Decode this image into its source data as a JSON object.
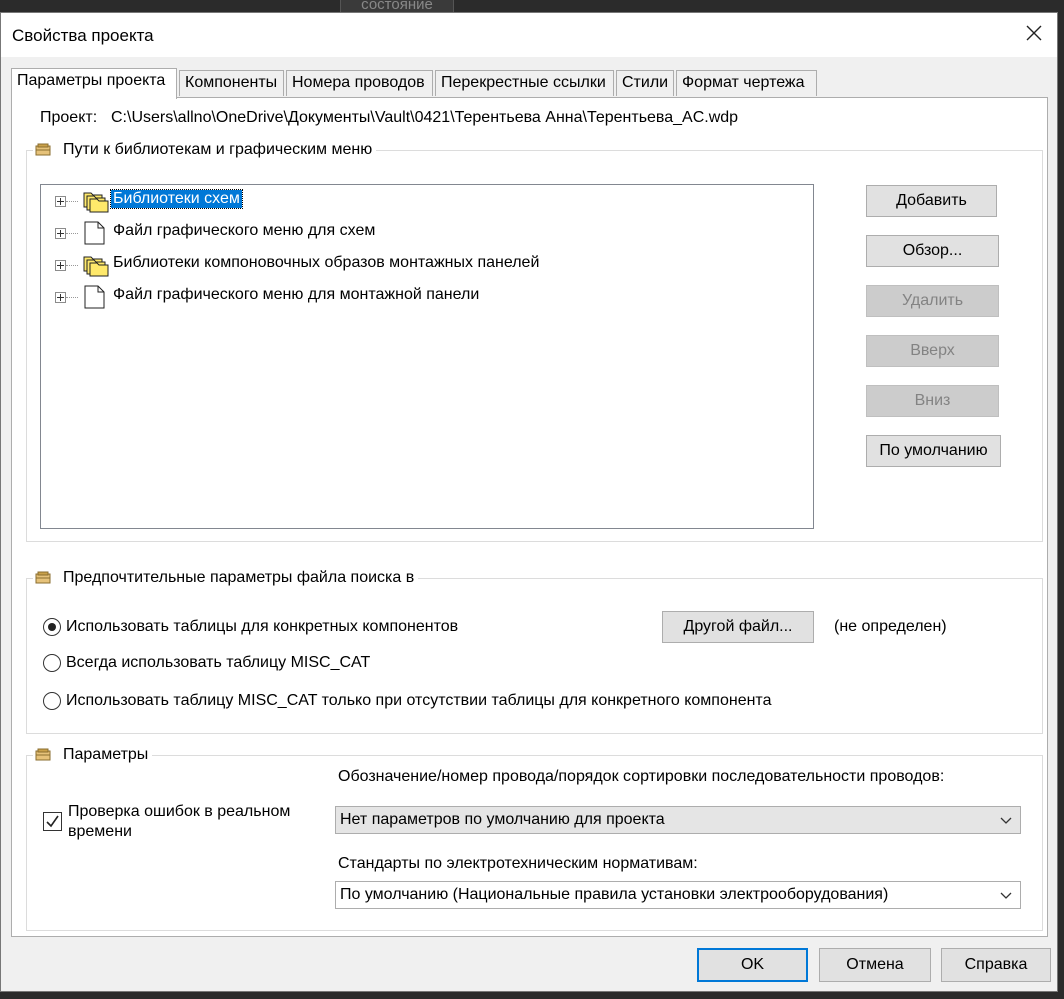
{
  "background_window": {
    "tab_label": "состояние"
  },
  "dialog": {
    "title": "Свойства проекта"
  },
  "tabs": [
    {
      "label": "Параметры проекта",
      "active": true
    },
    {
      "label": "Компоненты"
    },
    {
      "label": "Номера проводов"
    },
    {
      "label": "Перекрестные ссылки"
    },
    {
      "label": "Стили"
    },
    {
      "label": "Формат чертежа"
    }
  ],
  "project": {
    "label": "Проект:",
    "path": "C:\\Users\\allno\\OneDrive\\Документы\\Vault\\0421\\Терентьева Анна\\Терентьева_AC.wdp"
  },
  "library_group": {
    "title": "Пути к библиотекам и графическим меню",
    "tree_items": [
      {
        "label": "Библиотеки схем",
        "icon": "folders-icon",
        "selected": true
      },
      {
        "label": "Файл графического меню для схем",
        "icon": "file-icon"
      },
      {
        "label": "Библиотеки компоновочных образов монтажных панелей",
        "icon": "folders-icon"
      },
      {
        "label": "Файл графического меню для монтажной панели",
        "icon": "file-icon"
      }
    ],
    "buttons": {
      "add": "Добавить",
      "browse": "Обзор...",
      "remove": "Удалить",
      "up": "Вверх",
      "down": "Вниз",
      "default": "По умолчанию"
    }
  },
  "search_group": {
    "title": "Предпочтительные параметры файла поиска в",
    "options": [
      {
        "label": "Использовать таблицы для конкретных компонентов",
        "selected": true
      },
      {
        "label": "Всегда использовать таблицу MISC_CAT",
        "selected": false
      },
      {
        "label": "Использовать таблицу MISC_CAT только при отсутствии таблицы для конкретного компонента",
        "selected": false
      }
    ],
    "other_file_button": "Другой файл...",
    "other_file_status": "(не определен)"
  },
  "params_group": {
    "title": "Параметры",
    "realtime_check": {
      "label_line1": "Проверка ошибок в реальном",
      "label_line2": "времени",
      "checked": true
    },
    "wire_sort_label": "Обозначение/номер провода/порядок сортировки последовательности проводов:",
    "wire_sort_value": "Нет параметров по умолчанию для проекта",
    "standards_label": "Стандарты по электротехническим нормативам:",
    "standards_value": "По умолчанию (Национальные правила установки электрооборудования)"
  },
  "footer": {
    "ok": "OK",
    "cancel": "Отмена",
    "help": "Справка"
  },
  "colors": {
    "selection": "#0078d7",
    "folder_yellow": "#ffe96b",
    "disabled_text": "#838383"
  }
}
